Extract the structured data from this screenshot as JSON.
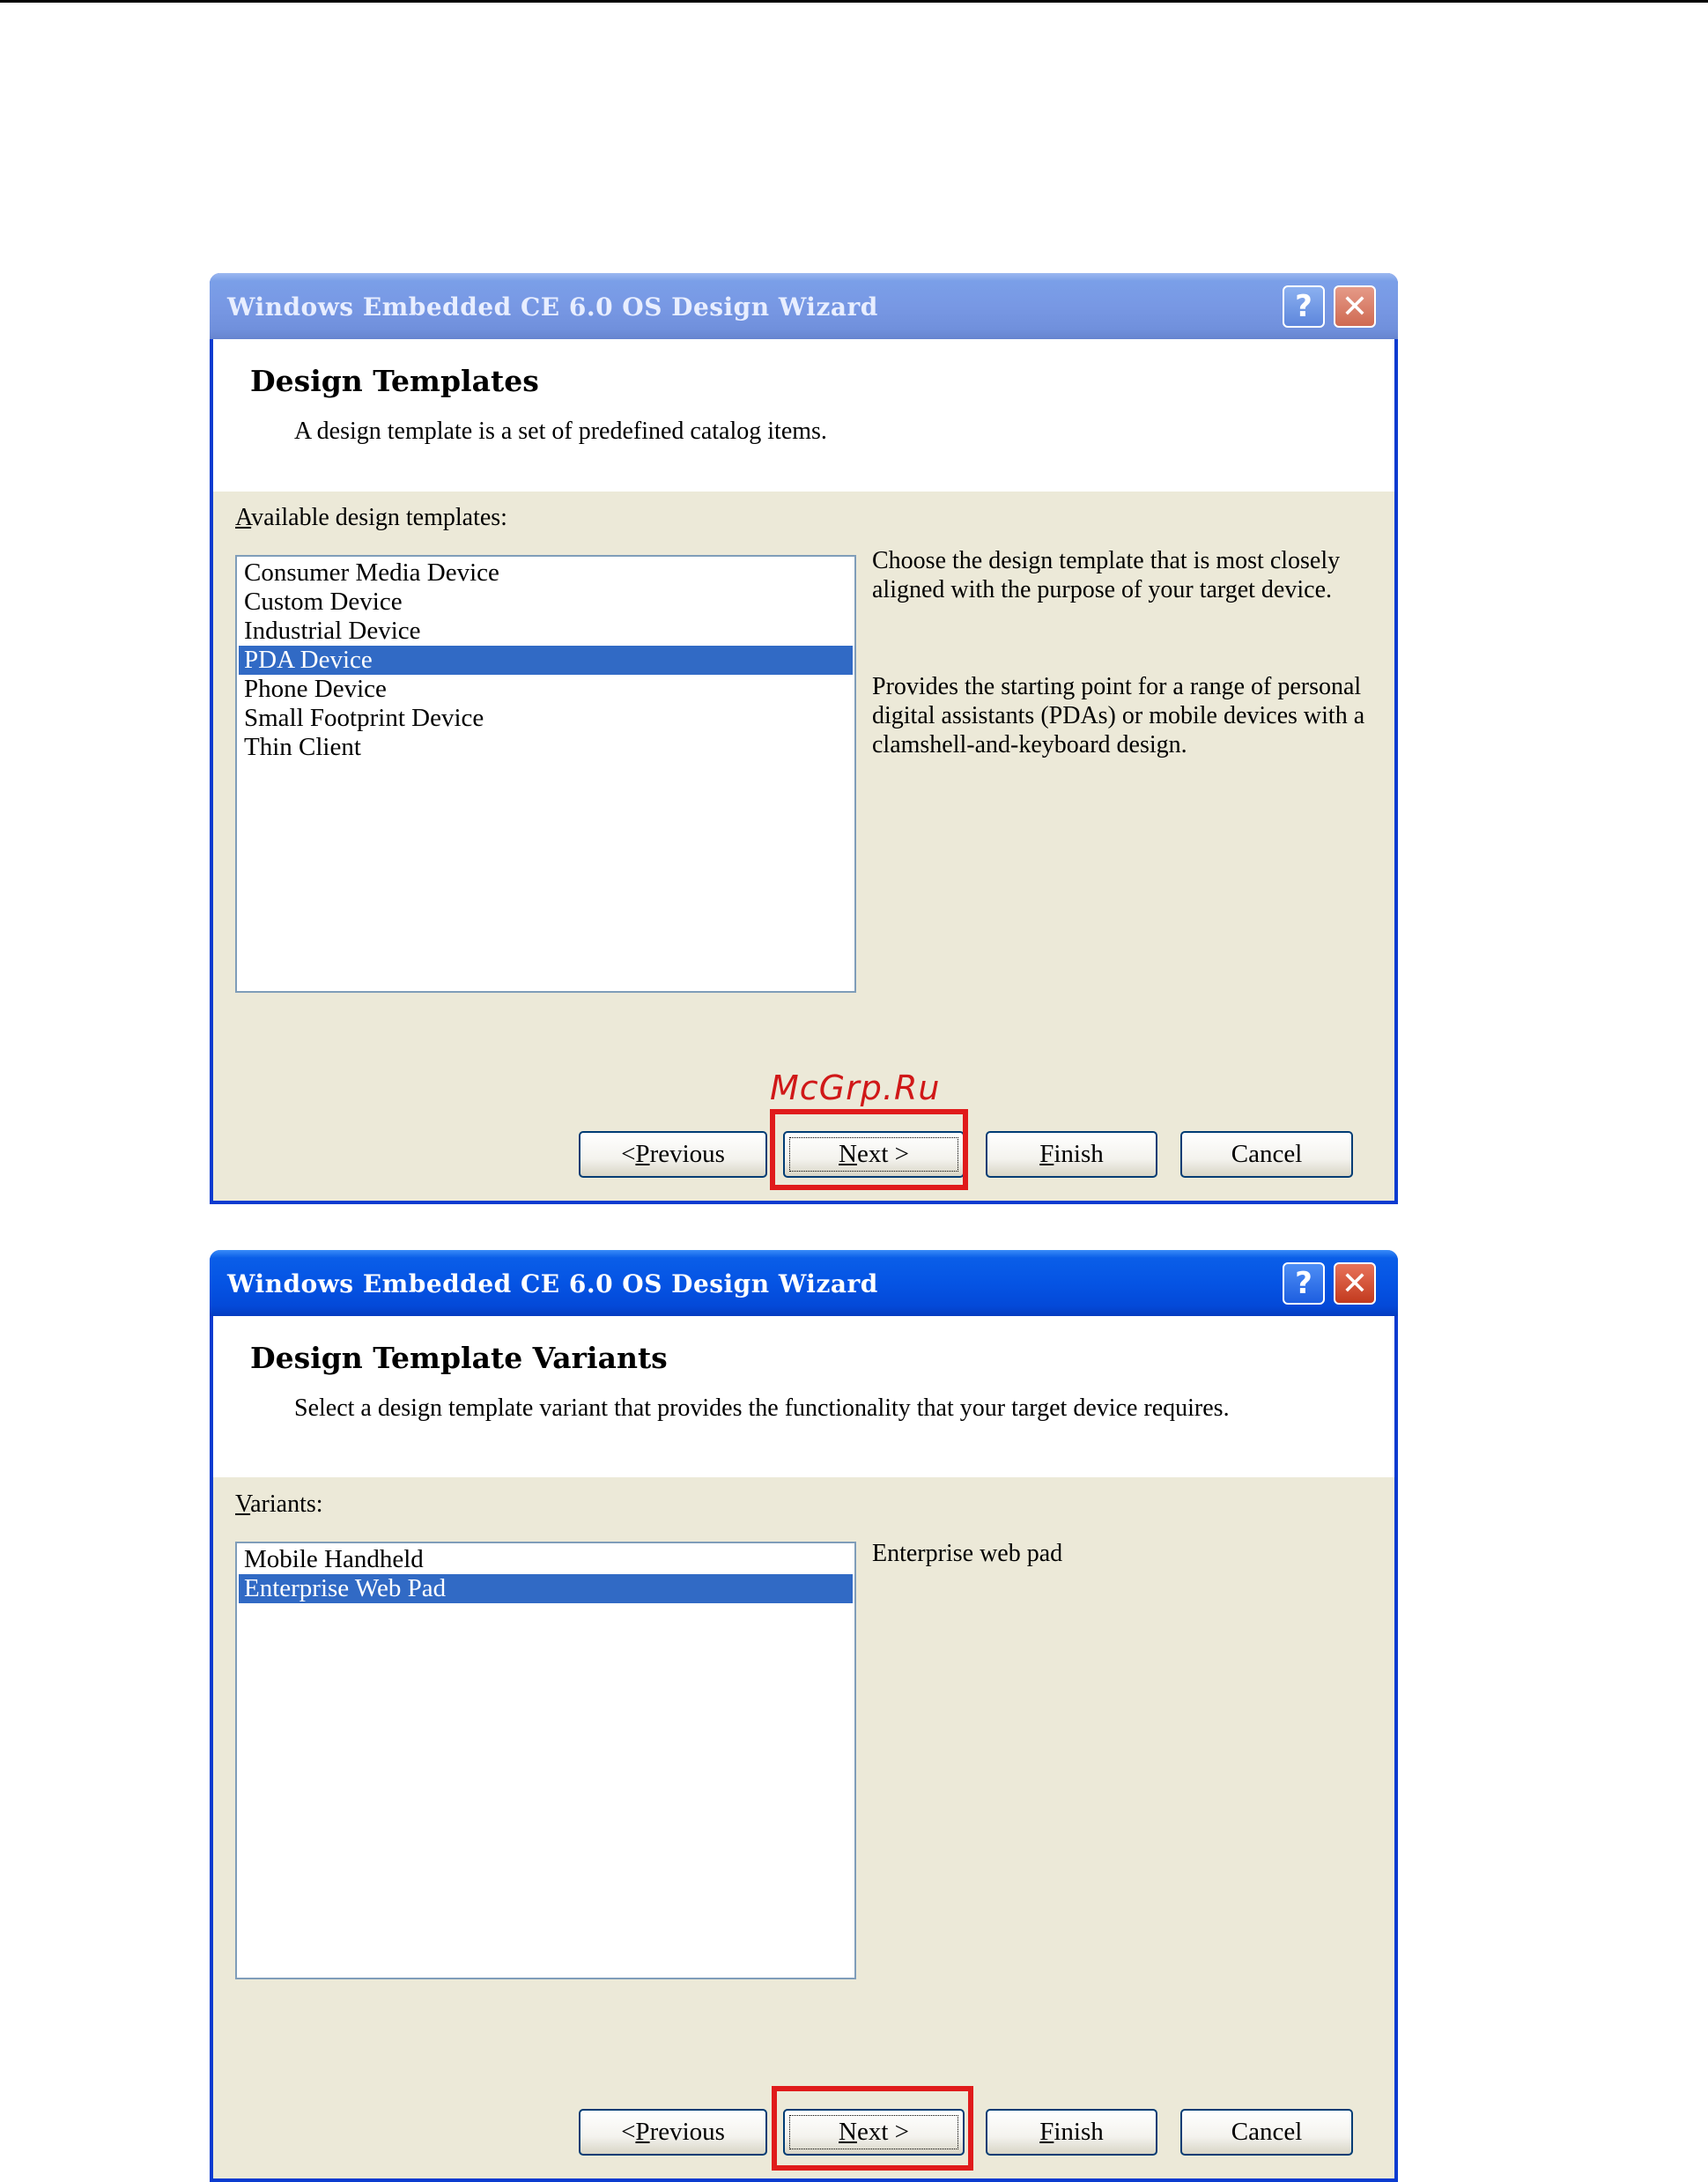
{
  "watermark": "McGrp.Ru",
  "dialogs": [
    {
      "title": "Windows Embedded CE 6.0 OS Design Wizard",
      "help_glyph": "?",
      "close_glyph": "✕",
      "header": {
        "title": "Design Templates",
        "description": "A design template is a set of predefined catalog items."
      },
      "list_label_mnemonic": "A",
      "list_label_rest": "vailable design templates:",
      "list_items": [
        "Consumer Media Device",
        "Custom Device",
        "Industrial Device",
        "PDA Device",
        "Phone Device",
        "Small Footprint Device",
        "Thin Client"
      ],
      "selected": "PDA Device",
      "info_1": "Choose the design template that is most closely aligned with the purpose of your target device.",
      "info_2": "Provides the starting point for a range of personal digital assistants (PDAs) or mobile devices with a clamshell-and-keyboard design.",
      "buttons": {
        "prev_pre": "< ",
        "prev_mnemonic": "P",
        "prev_rest": "revious",
        "next_mnemonic": "N",
        "next_rest": "ext >",
        "finish_mnemonic": "F",
        "finish_rest": "inish",
        "cancel": "Cancel"
      }
    },
    {
      "title": "Windows Embedded CE 6.0 OS Design Wizard",
      "help_glyph": "?",
      "close_glyph": "✕",
      "header": {
        "title": "Design Template Variants",
        "description": "Select a design template variant that provides the functionality that your target device requires."
      },
      "list_label_mnemonic": "V",
      "list_label_rest": "ariants:",
      "list_items": [
        "Mobile Handheld",
        "Enterprise Web Pad"
      ],
      "selected": "Enterprise Web Pad",
      "info_1": "Enterprise web pad",
      "buttons": {
        "prev_pre": "< ",
        "prev_mnemonic": "P",
        "prev_rest": "revious",
        "next_mnemonic": "N",
        "next_rest": "ext >",
        "finish_mnemonic": "F",
        "finish_rest": "inish",
        "cancel": "Cancel"
      }
    }
  ]
}
